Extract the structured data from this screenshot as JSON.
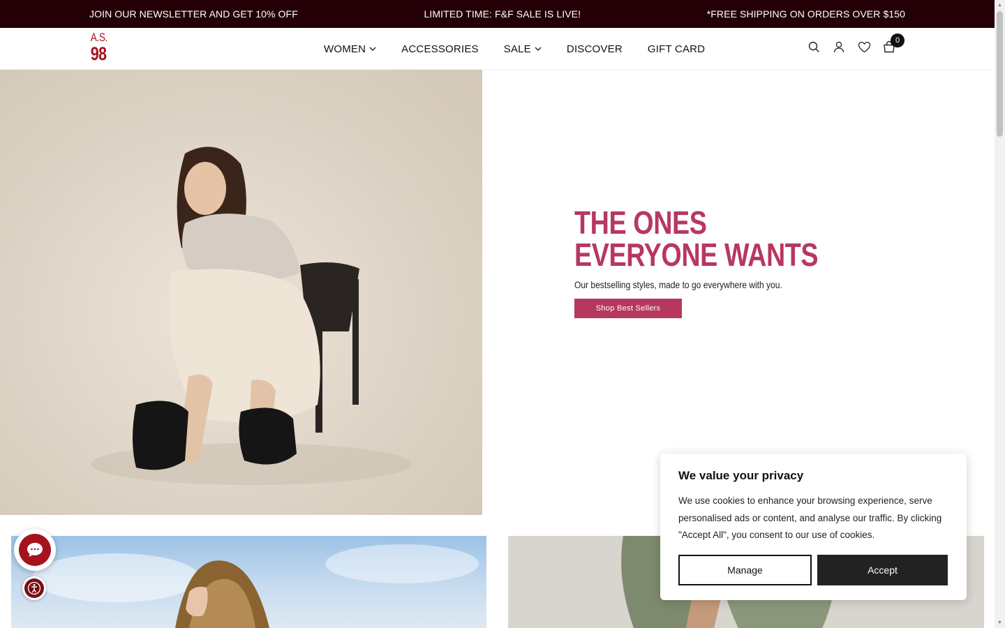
{
  "announcement": {
    "left": "JOIN OUR NEWSLETTER AND GET 10% OFF",
    "center": "LIMITED TIME: F&F SALE IS LIVE!",
    "right": "*FREE SHIPPING ON ORDERS OVER $150"
  },
  "logo": {
    "line1": "A.S.",
    "line2": "98",
    "color": "#a5131f"
  },
  "nav": {
    "items": [
      {
        "label": "WOMEN",
        "dropdown": true
      },
      {
        "label": "ACCESSORIES",
        "dropdown": false
      },
      {
        "label": "SALE",
        "dropdown": true
      },
      {
        "label": "DISCOVER",
        "dropdown": false
      },
      {
        "label": "GIFT CARD",
        "dropdown": false
      }
    ]
  },
  "header_icons": [
    "search-icon",
    "account-icon",
    "wishlist-heart-icon",
    "cart-bag-icon"
  ],
  "cart": {
    "count": "0"
  },
  "hero": {
    "title_line1": "THE ONES",
    "title_line2": "EVERYONE WANTS",
    "subtitle": "Our bestselling styles, made to go everywhere with you.",
    "cta": "Shop Best Sellers",
    "accent_color": "#b7385f"
  },
  "cookie": {
    "title": "We value your privacy",
    "body": "We use cookies to enhance your browsing experience, serve personalised ads or content, and analyse our traffic. By clicking \"Accept All\", you consent to our use of cookies.",
    "manage_label": "Manage",
    "accept_label": "Accept"
  },
  "colors": {
    "announcement_bg": "#240006",
    "brand_red": "#a5131f"
  }
}
